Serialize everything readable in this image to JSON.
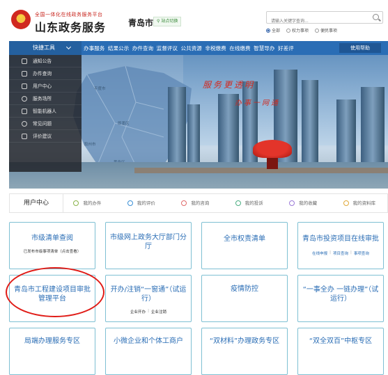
{
  "header": {
    "logo_subtitle": "全国一体化在线政务服务平台",
    "logo_title": "山东政务服务",
    "city": "青岛市",
    "switch_city": "站点切换",
    "search": {
      "placeholder": "请输入关键字查询...",
      "scopes": [
        {
          "label": "全部",
          "selected": true
        },
        {
          "label": "权力事项",
          "selected": false
        },
        {
          "label": "便民事项",
          "selected": false
        }
      ]
    }
  },
  "nav": {
    "quick_tools": "快捷工具",
    "items": [
      "办事服务",
      "结果公示",
      "办件查询",
      "监督评议",
      "公共资源",
      "非税缴费",
      "在线缴费",
      "智慧导办",
      "好差评"
    ],
    "help": "使用帮助"
  },
  "quick_menu": [
    {
      "label": "通知公告",
      "icon": "speaker-icon"
    },
    {
      "label": "办件查询",
      "icon": "send-icon"
    },
    {
      "label": "用户中心",
      "icon": "user-icon"
    },
    {
      "label": "服务场所",
      "icon": "location-icon"
    },
    {
      "label": "智能机器人",
      "icon": "robot-icon"
    },
    {
      "label": "常见问题",
      "icon": "question-icon"
    },
    {
      "label": "评价建议",
      "icon": "edit-icon"
    }
  ],
  "banner": {
    "slogan_1": "服务更透明",
    "slogan_2": "办事一网通"
  },
  "user_tabs": [
    {
      "label": "用户中心",
      "active": true,
      "icon": ""
    },
    {
      "label": "我的办件",
      "active": false,
      "icon": "pencil-icon"
    },
    {
      "label": "我的评价",
      "active": false,
      "icon": "thumb-icon"
    },
    {
      "label": "我的咨询",
      "active": false,
      "icon": "message-icon"
    },
    {
      "label": "我的投诉",
      "active": false,
      "icon": "phone-icon"
    },
    {
      "label": "我的收藏",
      "active": false,
      "icon": "star-icon"
    },
    {
      "label": "我的资料库",
      "active": false,
      "icon": "person-icon"
    }
  ],
  "cards": [
    {
      "title": "市级清单查阅",
      "note": "已发布市级事项清单（点击查看）",
      "links": []
    },
    {
      "title": "市级网上政务大厅部门分厅",
      "note": "",
      "links": []
    },
    {
      "title": "全市权责清单",
      "note": "",
      "links": []
    },
    {
      "title": "青岛市投资项目在线审批",
      "note": "",
      "links": [
        "在线申报",
        "项目查询",
        "事项查询"
      ]
    },
    {
      "title": "青岛市工程建设项目审批管理平台",
      "note": "",
      "links": []
    },
    {
      "title": "开办/注销“一窗通”（试运行）",
      "note": "",
      "links": [
        "企业开办",
        "企业注销"
      ]
    },
    {
      "title": "疫情防控",
      "note": "",
      "links": []
    },
    {
      "title": "“一事全办 一链办理”（试运行）",
      "note": "",
      "links": []
    },
    {
      "title": "局端办理服务专区",
      "note": "",
      "links": []
    },
    {
      "title": "小微企业和个体工商户",
      "note": "",
      "links": []
    },
    {
      "title": "“双材料”办理政务专区",
      "note": "",
      "links": []
    },
    {
      "title": "“双全双百”中枢专区",
      "note": "",
      "links": []
    }
  ],
  "colors": {
    "brand_blue": "#2a6db5",
    "card_border": "#7ec0d3",
    "slogan_red": "#d12a20",
    "highlight": "#e01b16"
  }
}
